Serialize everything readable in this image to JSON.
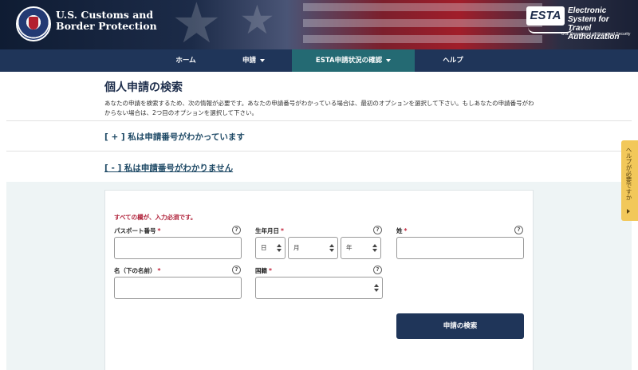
{
  "header": {
    "agency_line1": "U.S. Customs and",
    "agency_line2": "Border Protection",
    "esta_logo_text": "ESTA",
    "esta_tagline_1": "Electronic System for",
    "esta_tagline_2": "Travel Authorization",
    "esta_department": "U.S. Department of Homeland Security"
  },
  "nav": {
    "items": [
      {
        "label": "ホーム",
        "has_dropdown": false
      },
      {
        "label": "申請",
        "has_dropdown": true
      },
      {
        "label": "ESTA申請状況の確認",
        "has_dropdown": true,
        "active": true
      },
      {
        "label": "ヘルプ",
        "has_dropdown": false
      }
    ]
  },
  "page": {
    "title": "個人申請の検索",
    "intro": "あなたの申請を検索するため、次の情報が必要です。あなたの申請番号がわかっている場合は、最初のオプションを選択して下さい。もしあなたの申請番号がわからない場合は、2つ目のオプションを選択して下さい。"
  },
  "sections": {
    "known_label": "[ + ] 私は申請番号がわかっています",
    "unknown_label": "[ - ] 私は申請番号がわかりません"
  },
  "form": {
    "required_note": "すべての欄が、入力必須です。",
    "required_mark": "*",
    "help_glyph": "?",
    "passport_label": "パスポート番号",
    "passport_value": "",
    "dob_label": "生年月日",
    "dob_day": "日",
    "dob_month": "月",
    "dob_year": "年",
    "surname_label": "姓",
    "surname_value": "",
    "given_name_label": "名（下の名前）",
    "given_name_value": "",
    "nationality_label": "国籍",
    "nationality_value": "",
    "search_button": "申請の検索"
  },
  "help_tab": {
    "label": "ヘルプが必要ですか"
  },
  "colors": {
    "nav_bg": "#1f3559",
    "nav_active": "#246a73",
    "required_red": "#b0223a",
    "help_tab": "#f2c85a"
  }
}
